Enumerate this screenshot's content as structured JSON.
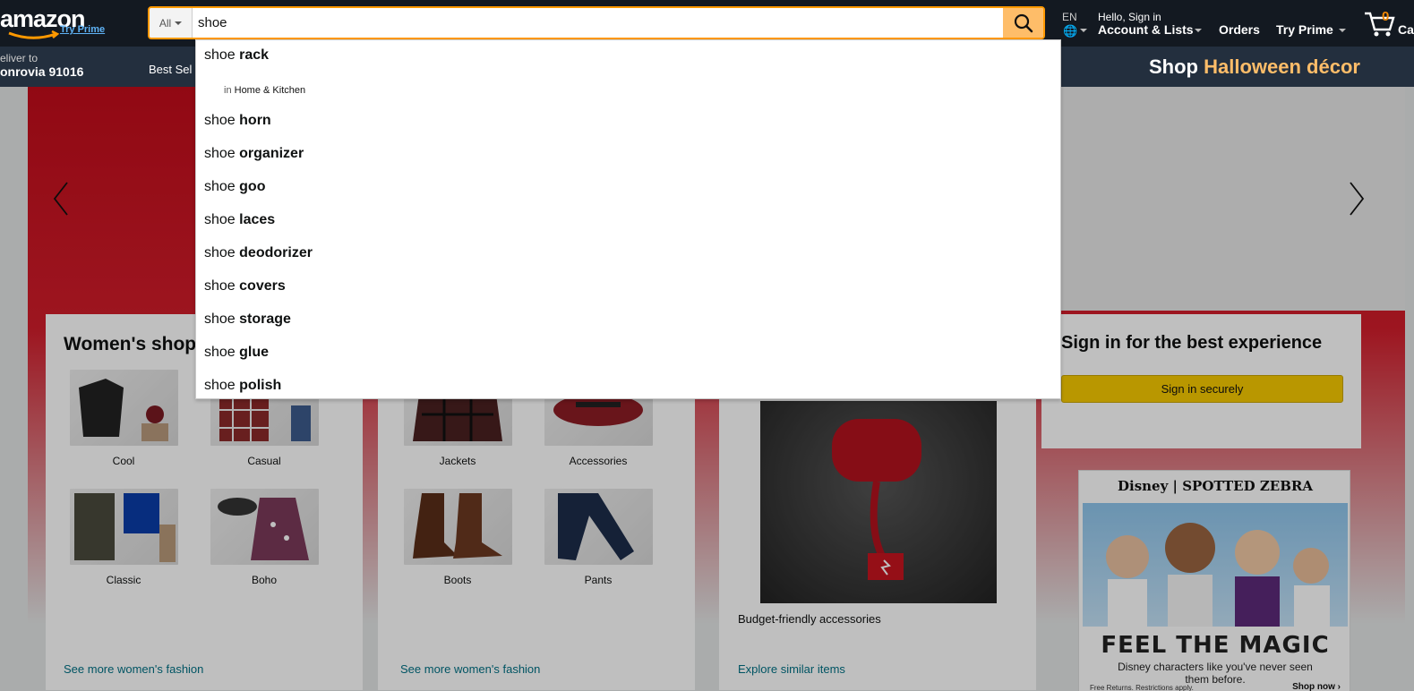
{
  "header": {
    "logo_text": "amazon",
    "logo_prime": "Try Prime",
    "search": {
      "category": "All",
      "value": "shoe"
    },
    "lang": "EN",
    "hello": "Hello, Sign in",
    "account": "Account & Lists",
    "orders": "Orders",
    "prime": "Try Prime",
    "cart_count": "0",
    "cart_label": "Cart",
    "deliver_to": "eliver to",
    "deliver_location": "onrovia 91016",
    "best_sellers": "Best Sel",
    "promo_prefix": "Shop",
    "promo_highlight": "Halloween décor"
  },
  "suggestions": {
    "department_prefix": "in",
    "department": "Home & Kitchen",
    "items": [
      {
        "prefix": "shoe",
        "bold": "rack"
      },
      {
        "prefix": "shoe",
        "bold": "horn"
      },
      {
        "prefix": "shoe",
        "bold": "organizer"
      },
      {
        "prefix": "shoe",
        "bold": "goo"
      },
      {
        "prefix": "shoe",
        "bold": "laces"
      },
      {
        "prefix": "shoe",
        "bold": "deodorizer"
      },
      {
        "prefix": "shoe",
        "bold": "covers"
      },
      {
        "prefix": "shoe",
        "bold": "storage"
      },
      {
        "prefix": "shoe",
        "bold": "glue"
      },
      {
        "prefix": "shoe",
        "bold": "polish"
      }
    ]
  },
  "cards": {
    "womens_shop": {
      "title": "Women's shop",
      "tiles": [
        "Cool",
        "Casual",
        "Classic",
        "Boho"
      ],
      "link": "See more women's fashion"
    },
    "womens_fashion": {
      "tiles": [
        "Jackets",
        "Accessories",
        "Boots",
        "Pants"
      ],
      "link": "See more women's fashion"
    },
    "budget": {
      "caption": "Budget-friendly accessories",
      "link": "Explore similar items"
    },
    "signin": {
      "title": "Sign in for the best experience",
      "button": "Sign in securely"
    }
  },
  "ad": {
    "brand": "Disney | SPOTTED ZEBRA",
    "headline": "FEEL THE MAGIC",
    "copy": "Disney characters like you've never seen them before.",
    "legal": "Free Returns. Restrictions apply.",
    "cta": "Shop now ›"
  },
  "colors": {
    "nav_top": "#131921",
    "nav_sub": "#232f3e",
    "accent": "#febd69",
    "link": "#007185"
  }
}
